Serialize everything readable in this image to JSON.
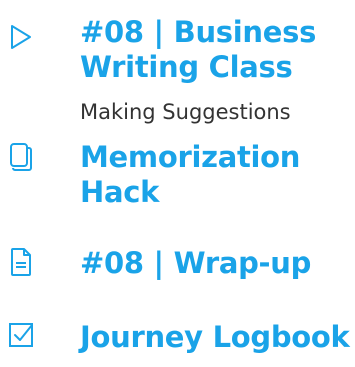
{
  "items": [
    {
      "icon": "play-outline-icon",
      "title_line1": "#08 | Business",
      "title_line2": "Writing Class",
      "subtitle": "Making Suggestions"
    },
    {
      "icon": "stacked-cards-icon",
      "title_line1": "Memorization",
      "title_line2": "Hack"
    },
    {
      "icon": "document-icon",
      "title_line1": "#08 | Wrap-up"
    },
    {
      "icon": "checkbox-checked-icon",
      "title_line1": "Journey Logbook"
    }
  ],
  "colors": {
    "accent": "#1aa3e8",
    "subtitle": "#333333"
  }
}
